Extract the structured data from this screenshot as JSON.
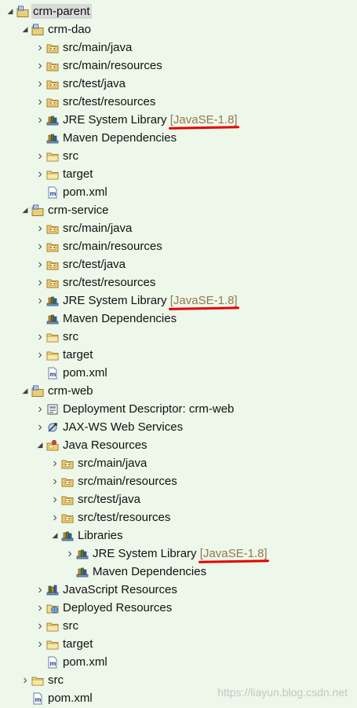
{
  "tree": [
    {
      "label": "crm-parent",
      "icon": "maven-project-icon",
      "depth": 0,
      "arrow": "expanded",
      "selected": true
    },
    {
      "label": "crm-dao",
      "icon": "maven-project-icon",
      "depth": 1,
      "arrow": "expanded"
    },
    {
      "label": "src/main/java",
      "icon": "source-folder-icon",
      "depth": 2,
      "arrow": "collapsed"
    },
    {
      "label": "src/main/resources",
      "icon": "source-folder-icon",
      "depth": 2,
      "arrow": "collapsed"
    },
    {
      "label": "src/test/java",
      "icon": "source-folder-icon",
      "depth": 2,
      "arrow": "collapsed"
    },
    {
      "label": "src/test/resources",
      "icon": "source-folder-icon",
      "depth": 2,
      "arrow": "collapsed"
    },
    {
      "label": "JRE System Library",
      "tag": "[JavaSE-1.8]",
      "icon": "library-icon",
      "depth": 2,
      "arrow": "collapsed",
      "underline": true
    },
    {
      "label": "Maven Dependencies",
      "icon": "library-icon",
      "depth": 2,
      "arrow": "none"
    },
    {
      "label": "src",
      "icon": "folder-icon",
      "depth": 2,
      "arrow": "collapsed"
    },
    {
      "label": "target",
      "icon": "folder-icon",
      "depth": 2,
      "arrow": "collapsed"
    },
    {
      "label": "pom.xml",
      "icon": "pom-file-icon",
      "depth": 2,
      "arrow": "none"
    },
    {
      "label": "crm-service",
      "icon": "maven-project-icon",
      "depth": 1,
      "arrow": "expanded"
    },
    {
      "label": "src/main/java",
      "icon": "source-folder-icon",
      "depth": 2,
      "arrow": "collapsed"
    },
    {
      "label": "src/main/resources",
      "icon": "source-folder-icon",
      "depth": 2,
      "arrow": "collapsed"
    },
    {
      "label": "src/test/java",
      "icon": "source-folder-icon",
      "depth": 2,
      "arrow": "collapsed"
    },
    {
      "label": "src/test/resources",
      "icon": "source-folder-icon",
      "depth": 2,
      "arrow": "collapsed"
    },
    {
      "label": "JRE System Library",
      "tag": "[JavaSE-1.8]",
      "icon": "library-icon",
      "depth": 2,
      "arrow": "collapsed",
      "underline": true
    },
    {
      "label": "Maven Dependencies",
      "icon": "library-icon",
      "depth": 2,
      "arrow": "none"
    },
    {
      "label": "src",
      "icon": "folder-icon",
      "depth": 2,
      "arrow": "collapsed"
    },
    {
      "label": "target",
      "icon": "folder-icon",
      "depth": 2,
      "arrow": "collapsed"
    },
    {
      "label": "pom.xml",
      "icon": "pom-file-icon",
      "depth": 2,
      "arrow": "none"
    },
    {
      "label": "crm-web",
      "icon": "maven-project-icon",
      "depth": 1,
      "arrow": "expanded"
    },
    {
      "label": "Deployment Descriptor: crm-web",
      "icon": "deployment-descriptor-icon",
      "depth": 2,
      "arrow": "collapsed"
    },
    {
      "label": "JAX-WS Web Services",
      "icon": "web-services-icon",
      "depth": 2,
      "arrow": "collapsed"
    },
    {
      "label": "Java Resources",
      "icon": "java-resources-icon",
      "depth": 2,
      "arrow": "expanded"
    },
    {
      "label": "src/main/java",
      "icon": "source-folder-icon",
      "depth": 3,
      "arrow": "collapsed"
    },
    {
      "label": "src/main/resources",
      "icon": "source-folder-icon",
      "depth": 3,
      "arrow": "collapsed"
    },
    {
      "label": "src/test/java",
      "icon": "source-folder-icon",
      "depth": 3,
      "arrow": "collapsed"
    },
    {
      "label": "src/test/resources",
      "icon": "source-folder-icon",
      "depth": 3,
      "arrow": "collapsed"
    },
    {
      "label": "Libraries",
      "icon": "library-icon",
      "depth": 3,
      "arrow": "expanded"
    },
    {
      "label": "JRE System Library",
      "tag": "[JavaSE-1.8]",
      "icon": "library-icon",
      "depth": 4,
      "arrow": "collapsed",
      "underline": true
    },
    {
      "label": "Maven Dependencies",
      "icon": "library-icon",
      "depth": 4,
      "arrow": "none"
    },
    {
      "label": "JavaScript Resources",
      "icon": "javascript-resources-icon",
      "depth": 2,
      "arrow": "collapsed"
    },
    {
      "label": "Deployed Resources",
      "icon": "deployed-resources-icon",
      "depth": 2,
      "arrow": "collapsed"
    },
    {
      "label": "src",
      "icon": "folder-icon",
      "depth": 2,
      "arrow": "collapsed"
    },
    {
      "label": "target",
      "icon": "folder-icon",
      "depth": 2,
      "arrow": "collapsed"
    },
    {
      "label": "pom.xml",
      "icon": "pom-file-icon",
      "depth": 2,
      "arrow": "none"
    },
    {
      "label": "src",
      "icon": "folder-icon",
      "depth": 1,
      "arrow": "collapsed"
    },
    {
      "label": "pom.xml",
      "icon": "pom-file-icon",
      "depth": 1,
      "arrow": "none"
    }
  ],
  "watermark": "https://liayun.blog.csdn.net",
  "colors": {
    "background": "#edf7ea",
    "tag": "#94784a",
    "underline": "#e60000",
    "selection": "#d9d9d9"
  }
}
